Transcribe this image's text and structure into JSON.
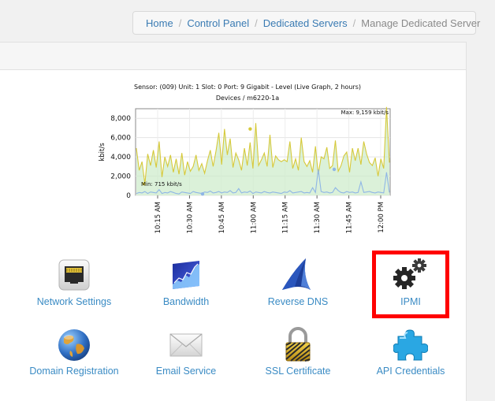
{
  "breadcrumb": {
    "items": [
      "Home",
      "Control Panel",
      "Dedicated Servers"
    ],
    "current": "Manage Dedicated Server"
  },
  "graph": {
    "title_line1": "Sensor: (009) Unit: 1 Slot: 0 Port: 9 Gigabit - Level (Live Graph, 2 hours)",
    "title_line2": "Devices / m6220-1a",
    "max_label": "Max: 9,159 kbit/s",
    "min_label": "Min: 715 kbit/s"
  },
  "services": [
    {
      "label": "Network Settings",
      "icon": "network-port-icon"
    },
    {
      "label": "Bandwidth",
      "icon": "bandwidth-chart-icon"
    },
    {
      "label": "Reverse DNS",
      "icon": "reverse-dns-icon"
    },
    {
      "label": "IPMI",
      "icon": "gears-icon"
    },
    {
      "label": "Domain Registration",
      "icon": "globe-icon"
    },
    {
      "label": "Email Service",
      "icon": "envelope-icon"
    },
    {
      "label": "SSL Certificate",
      "icon": "padlock-icon"
    },
    {
      "label": "API Credentials",
      "icon": "puzzle-icon"
    }
  ],
  "highlight_color": "#ff0000",
  "chart_data": {
    "type": "line",
    "title": "Sensor: (009) Unit: 1 Slot: 0 Port: 9 Gigabit - Level (Live Graph, 2 hours)",
    "subtitle": "Devices / m6220-1a",
    "ylabel": "kbit/s",
    "ylim": [
      0,
      9000
    ],
    "yticks": [
      0,
      2000,
      4000,
      6000,
      8000
    ],
    "ytick_labels": [
      "0",
      "2,000",
      "4,000",
      "6,000",
      "8,000"
    ],
    "xtick_labels": [
      "10:15 AM",
      "10:30 AM",
      "10:45 AM",
      "11:00 AM",
      "11:15 AM",
      "11:30 AM",
      "11:45 AM",
      "12:00 PM"
    ],
    "annotations": [
      "Max: 9,159 kbit/s",
      "Min: 715 kbit/s"
    ],
    "grid": true,
    "series": [
      {
        "color": "#d6c93a",
        "values": [
          4900,
          2600,
          3500,
          1200,
          4300,
          3100,
          4700,
          2900,
          5600,
          1900,
          4000,
          3000,
          4200,
          2400,
          3800,
          2200,
          4400,
          2100,
          3500,
          2500,
          3000,
          4200,
          2600,
          3300,
          2300,
          3600,
          4700,
          3000,
          4600,
          6500,
          3200,
          6900,
          4200,
          5900,
          2900,
          4400,
          3700,
          2600,
          4900,
          3100,
          5500,
          2800,
          7500,
          3100,
          3700,
          4400,
          3000,
          6300,
          2900,
          4100,
          3700,
          3500,
          3700,
          3500,
          5600,
          2800,
          3800,
          2600,
          6000,
          3500,
          3000,
          3600,
          2400,
          5100,
          2200,
          4000,
          3800,
          5000,
          2800,
          3100,
          5700,
          2500,
          3100,
          4100,
          4500,
          2400,
          4900,
          3600,
          4900,
          3200,
          5600,
          4300,
          3400,
          3100,
          3900,
          2000,
          3800,
          2800,
          9200,
          3400
        ]
      },
      {
        "color": "#8fb6e6",
        "values": [
          200,
          300,
          250,
          400,
          200,
          350,
          300,
          250,
          600,
          200,
          300,
          250,
          400,
          300,
          200,
          150,
          350,
          300,
          250,
          200,
          400,
          300,
          250,
          200,
          350,
          300,
          450,
          250,
          300,
          400,
          250,
          350,
          300,
          500,
          250,
          300,
          700,
          250,
          350,
          300,
          450,
          200,
          350,
          300,
          250,
          400,
          300,
          250,
          350,
          300,
          250,
          200,
          350,
          300,
          500,
          250,
          300,
          350,
          400,
          250,
          300,
          250,
          800,
          300,
          2700,
          400,
          300,
          350,
          250,
          300,
          800,
          500,
          300,
          250,
          400,
          300,
          350,
          250,
          300,
          1400,
          300,
          350,
          400,
          300,
          250,
          350,
          300,
          250,
          2400,
          300
        ]
      }
    ]
  }
}
